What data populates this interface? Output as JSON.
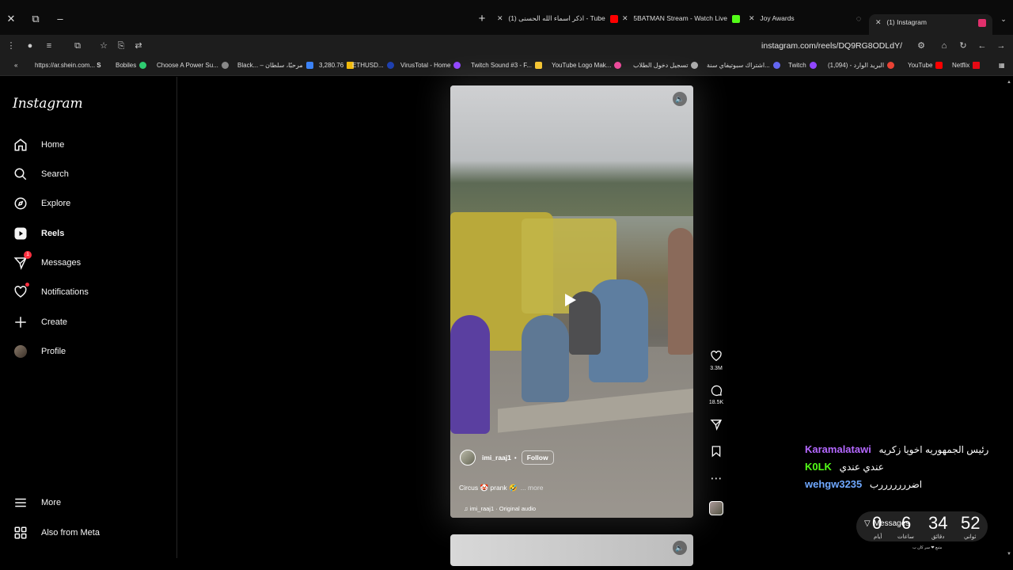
{
  "tabs": [
    {
      "title": "(1) اذكر اسماء الله الحسنى - Tube",
      "favicon_color": "#ff0000"
    },
    {
      "title": "5BATMAN Stream - Watch Live",
      "favicon_color": "#53fc18"
    },
    {
      "title": "Joy Awards",
      "favicon_color": "#888888"
    },
    {
      "title": "(1) Instagram",
      "favicon_color": "#e1306c"
    }
  ],
  "toolbar": {
    "url": "instagram.com/reels/DQ9RG8ODLdY/"
  },
  "bookmarks": [
    {
      "label": "https://ar.shein.com...",
      "icon": "S"
    },
    {
      "label": "Bobiles",
      "color": "#2ecc71"
    },
    {
      "label": "Choose A Power Su...",
      "color": "#888"
    },
    {
      "label": "Black... – مرحبًا، سلطان",
      "color": "#3b82f6"
    },
    {
      "label": "3,280.76",
      "color": "#f0b90b"
    },
    {
      "label": "ETHUSD...",
      "color": "#1e40af"
    },
    {
      "label": "VirusTotal - Home",
      "color": "#9146ff"
    },
    {
      "label": "Twitch Sound #3 - F...",
      "color": "#f4c430"
    },
    {
      "label": "YouTube Logo Mak...",
      "color": "#ec4899"
    },
    {
      "label": "تسجيل دخول الطلاب",
      "color": "#aaa"
    },
    {
      "label": "اشتراك سبوتيفاي سنة...",
      "color": "#6366f1"
    },
    {
      "label": "Twitch",
      "color": "#9146ff"
    },
    {
      "label": "البريد الوارد - (1,094)",
      "color": "#ea4335"
    },
    {
      "label": "YouTube",
      "color": "#ff0000"
    },
    {
      "label": "Netflix",
      "color": "#e50914"
    }
  ],
  "sidebar": {
    "logo": "Instagram",
    "items": [
      {
        "label": "Home"
      },
      {
        "label": "Search"
      },
      {
        "label": "Explore"
      },
      {
        "label": "Reels"
      },
      {
        "label": "Messages",
        "badge": "1"
      },
      {
        "label": "Notifications"
      },
      {
        "label": "Create"
      },
      {
        "label": "Profile"
      }
    ],
    "bottom": [
      {
        "label": "More"
      },
      {
        "label": "Also from Meta"
      }
    ]
  },
  "reel": {
    "username": "imi_raaj1",
    "follow": "Follow",
    "caption": "Circus 🤡 prank 🤣",
    "more": "... more",
    "audio": "imi_raaj1 · Original audio",
    "likes": "3.3M",
    "comments": "18.5K"
  },
  "chat": [
    {
      "user": "Karamalatawi",
      "color": "#b468ff",
      "message": "رئيس الجمهوريه اخويا زكريه"
    },
    {
      "user": "K0LK",
      "color": "#53fc18",
      "message": "عندي عندي"
    },
    {
      "user": "wehgw3235",
      "color": "#6fa8ff",
      "message": "اضرررررررب"
    }
  ],
  "timer": {
    "days": "0",
    "days_label": "أيام",
    "hours": "6",
    "hours_label": "ساعات",
    "minutes": "34",
    "minutes_label": "دقائق",
    "seconds": "52",
    "seconds_label": "ثواني",
    "messages_label": "Messages",
    "sub": "متبع ❤ سر كان ب"
  }
}
